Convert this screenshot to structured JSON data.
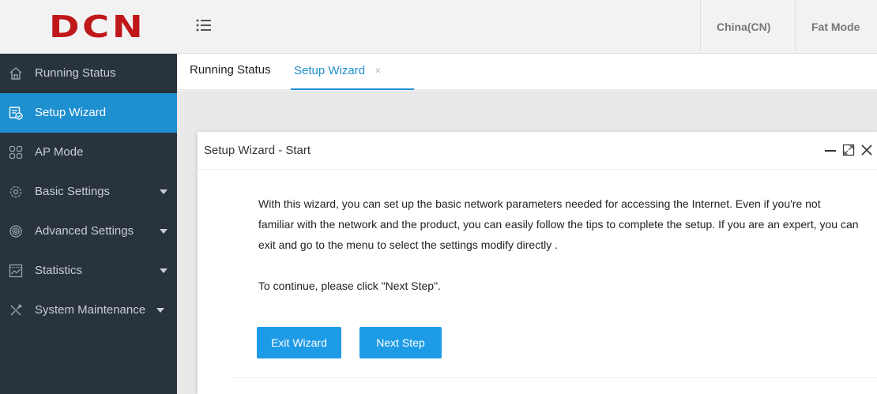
{
  "header": {
    "logo": "DCN",
    "region": "China(CN)",
    "mode": "Fat Mode"
  },
  "sidebar": {
    "items": [
      {
        "label": "Running Status",
        "icon": "home-icon"
      },
      {
        "label": "Setup Wizard",
        "icon": "wizard-icon",
        "active": true
      },
      {
        "label": "AP Mode",
        "icon": "grid-icon"
      },
      {
        "label": "Basic Settings",
        "icon": "settings-icon",
        "expandable": true
      },
      {
        "label": "Advanced Settings",
        "icon": "gear-icon",
        "expandable": true
      },
      {
        "label": "Statistics",
        "icon": "chart-icon",
        "expandable": true
      },
      {
        "label": "System Maintenance",
        "icon": "tools-icon",
        "expandable": true
      }
    ]
  },
  "tabs": [
    {
      "label": "Running Status",
      "active": false
    },
    {
      "label": "Setup Wizard",
      "active": true,
      "close": "×"
    }
  ],
  "dialog": {
    "title": "Setup Wizard - Start",
    "paragraph1": "With this wizard, you can set up the basic network parameters needed for accessing the Internet. Even if you're not familiar with the network and the product, you can easily follow the tips to complete the setup. If you are an expert, you can exit and go to the menu to select the settings modify directly .",
    "paragraph2": "To continue, please click \"Next Step\".",
    "exit_label": "Exit Wizard",
    "next_label": "Next Step"
  },
  "colors": {
    "accent": "#1e8fcf",
    "button": "#1e9be6",
    "sidebar_bg": "#28333e",
    "logo": "#c0171b"
  }
}
